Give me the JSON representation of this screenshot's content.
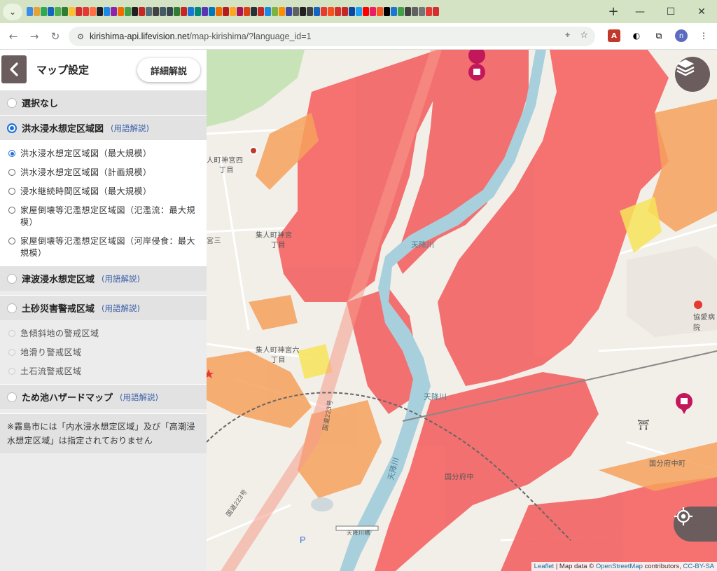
{
  "browser": {
    "url_host": "kirishima-api.lifevision.net",
    "url_path": "/map-kirishima/?language_id=1",
    "profile_initial": "n",
    "pdf_ext_label": "A"
  },
  "panel": {
    "title": "マップ設定",
    "detail_button": "詳細解説",
    "sections": {
      "none": {
        "label": "選択なし"
      },
      "flood": {
        "label": "洪水浸水想定区域図",
        "help": "(用語解説)",
        "options": [
          "洪水浸水想定区域図（最大規模）",
          "洪水浸水想定区域図（計画規模）",
          "浸水継続時間区域図（最大規模）",
          "家屋倒壊等氾濫想定区域図（氾濫流：最大規模）",
          "家屋倒壊等氾濫想定区域図（河岸侵食：最大規模）"
        ]
      },
      "tsunami": {
        "label": "津波浸水想定区域",
        "help": "(用語解説)"
      },
      "landslide": {
        "label": "土砂災害警戒区域",
        "help": "(用語解説)",
        "options": [
          "急傾斜地の警戒区域",
          "地滑り警戒区域",
          "土石流警戒区域"
        ]
      },
      "pond": {
        "label": "ため池ハザードマップ",
        "help": "(用語解説)"
      }
    },
    "note": "※霧島市には「内水浸水想定区域」及び「高潮浸水想定区域」は指定されておりません"
  },
  "map": {
    "labels": {
      "area1": "人町神宮四",
      "area1b": "丁目",
      "area2": "集人町神宮",
      "area2b": "丁目",
      "area3": "集人町神宮六",
      "area3b": "丁目",
      "area4": "宮三",
      "area5": "国分府中",
      "area6": "国分府中町",
      "hospital": "協愛病院",
      "river1": "天降川",
      "river2": "天降川",
      "river3": "天降川",
      "bridge": "天降川橋",
      "route": "国道223号",
      "route2": "国道223号",
      "parking": "P"
    },
    "attribution": {
      "leaflet": "Leaflet",
      "mid": " | Map data © ",
      "osm": "OpenStreetMap",
      "contrib": " contributors, ",
      "license": "CC-BY-SA"
    },
    "colors": {
      "flood_deep": "#f46a6a",
      "flood_mid": "#f6a15c",
      "flood_shallow": "#f7e45a",
      "river": "#a8d0dc",
      "land": "#f2efe9",
      "forest": "#c9e3b8",
      "ui_button": "#6b5d5d",
      "accent": "#1e6fd9"
    }
  }
}
